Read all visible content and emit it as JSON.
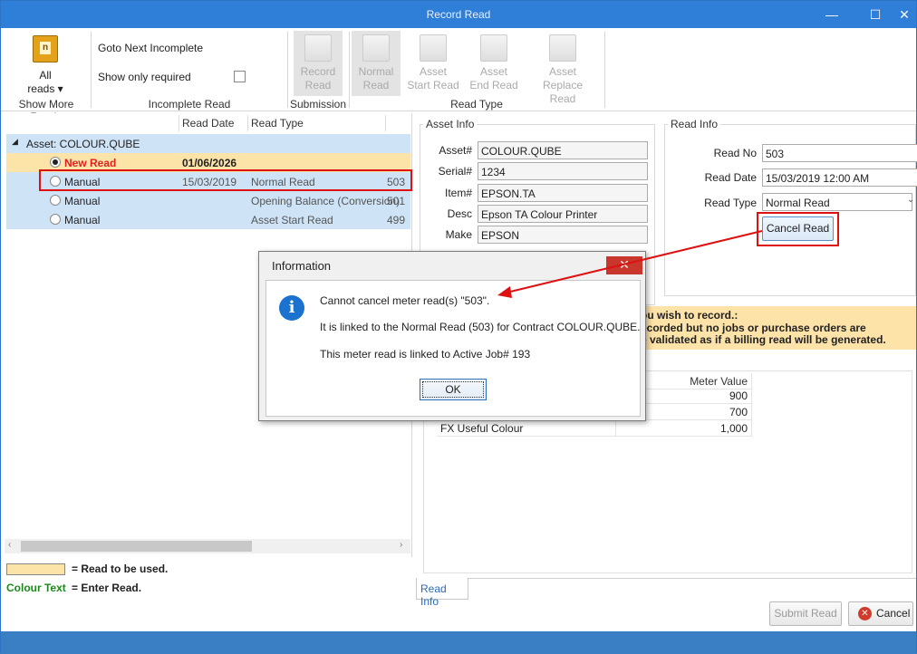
{
  "window": {
    "title": "Record Read",
    "minimize": "—",
    "maximize": "☐",
    "close": "✕"
  },
  "ribbon": {
    "all_reads": "All",
    "all_reads2": "reads ▾",
    "show_more_label": "Show More Reads",
    "goto_next": "Goto Next Incomplete",
    "show_only_required": "Show only required",
    "incomplete_label": "Incomplete Read",
    "record_read": [
      "Record",
      "Read"
    ],
    "submission_label": "Submission",
    "normal_read": [
      "Normal",
      "Read"
    ],
    "asset_start": [
      "Asset",
      "Start Read"
    ],
    "asset_end": [
      "Asset",
      "End Read"
    ],
    "asset_replace": [
      "Asset",
      "Replace Read"
    ],
    "read_type_label": "Read Type"
  },
  "list": {
    "columns": [
      "Read Date",
      "Read Type"
    ],
    "group": "Asset: COLOUR.QUBE",
    "rows": [
      {
        "type": "New Read",
        "date": "01/06/2026",
        "read_type": "",
        "no": ""
      },
      {
        "type": "Manual",
        "date": "15/03/2019",
        "read_type": "Normal Read",
        "no": "503"
      },
      {
        "type": "Manual",
        "date": "",
        "read_type": "Opening Balance (Conversion)",
        "no": "501"
      },
      {
        "type": "Manual",
        "date": "",
        "read_type": "Asset Start Read",
        "no": "499"
      }
    ]
  },
  "legend": {
    "to_be_used": "= Read to be used.",
    "colour_text": "Colour Text",
    "enter_read": "= Enter Read."
  },
  "asset_info": {
    "title": "Asset Info",
    "fields": [
      {
        "label": "Asset#",
        "value": "COLOUR.QUBE"
      },
      {
        "label": "Serial#",
        "value": "1234"
      },
      {
        "label": "Item#",
        "value": "EPSON.TA"
      },
      {
        "label": "Desc",
        "value": "Epson TA Colour Printer"
      },
      {
        "label": "Make",
        "value": "EPSON"
      }
    ]
  },
  "read_info": {
    "title": "Read Info",
    "read_no_label": "Read No",
    "read_no": "503",
    "read_date_label": "Read Date",
    "read_date": "15/03/2019 12:00 AM",
    "read_type_label": "Read Type",
    "read_type": "Normal Read",
    "cancel_button": "Cancel Read"
  },
  "notice": {
    "line1": "ou wish to record.:",
    "line2": "ecorded but no jobs or purchase orders are",
    "line3": "e validated as if a billing read will be generated."
  },
  "grid": {
    "header": "Meter Value",
    "rows": [
      {
        "name": "",
        "value": "900"
      },
      {
        "name": "",
        "value": "700"
      },
      {
        "name": "FX Useful Colour",
        "value": "1,000"
      }
    ]
  },
  "tabs": {
    "read_info": "Read Info"
  },
  "footer": {
    "submit": "Submit Read",
    "cancel": "Cancel"
  },
  "dialog": {
    "title": "Information",
    "close": "✕",
    "line1": "Cannot cancel meter read(s) \"503\".",
    "line2": "It is linked to the Normal Read (503) for Contract COLOUR.QUBE.",
    "line3": "This meter read is linked to Active Job# 193",
    "ok": "OK"
  }
}
